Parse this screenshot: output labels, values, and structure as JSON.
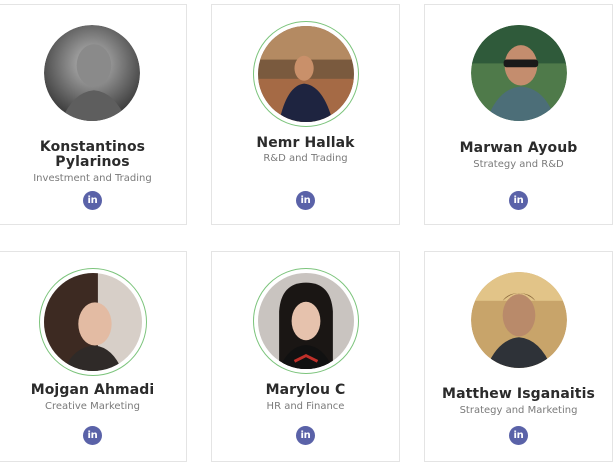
{
  "team": [
    {
      "name": "Konstantinos Pylarinos",
      "role": "Investment and Trading",
      "social": "linkedin-icon",
      "social_label": "in"
    },
    {
      "name": "Nemr Hallak",
      "role": "R&D and Trading",
      "social": "linkedin-icon",
      "social_label": "in"
    },
    {
      "name": "Marwan Ayoub",
      "role": "Strategy and R&D",
      "social": "linkedin-icon",
      "social_label": "in"
    },
    {
      "name": "Mojgan Ahmadi",
      "role": "Creative Marketing",
      "social": "linkedin-icon",
      "social_label": "in"
    },
    {
      "name": "Marylou C",
      "role": "HR and Finance",
      "social": "linkedin-icon",
      "social_label": "in"
    },
    {
      "name": "Matthew Isganaitis",
      "role": "Strategy and Marketing",
      "social": "linkedin-icon",
      "social_label": "in"
    }
  ],
  "colors": {
    "linkedin": "#5a62a8",
    "avatar_ring": "#7cc47c",
    "card_border": "#e4e4e4",
    "name_text": "#2b2b2b",
    "role_text": "#7a7a7a"
  }
}
